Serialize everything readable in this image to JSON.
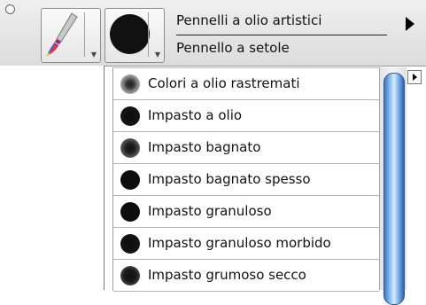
{
  "toolbar": {
    "brush_category": "Pennelli a olio artistici",
    "brush_variant": "Pennello a setole",
    "icons": [
      "close-icon",
      "brush-category-icon",
      "brush-variant-icon",
      "menu-arrow-icon",
      "well-dropdown-arrow-icon"
    ]
  },
  "variant_list": {
    "items": [
      {
        "label": "Colori a olio rastremati",
        "icon": "soft-gray-dot-icon",
        "icon_color": "#5a5a5a"
      },
      {
        "label": "Impasto a olio",
        "icon": "black-dot-icon",
        "icon_color": "#111111"
      },
      {
        "label": "Impasto bagnato",
        "icon": "soft-gray-dot-icon",
        "icon_color": "#444444"
      },
      {
        "label": "Impasto bagnato spesso",
        "icon": "black-dot-icon",
        "icon_color": "#0d0d0d"
      },
      {
        "label": "Impasto granuloso",
        "icon": "black-dot-icon",
        "icon_color": "#0d0d0d"
      },
      {
        "label": "Impasto granuloso morbido",
        "icon": "black-dot-icon",
        "icon_color": "#141414"
      },
      {
        "label": "Impasto grumoso secco",
        "icon": "soft-gray-dot-icon",
        "icon_color": "#2a2a2a"
      }
    ]
  },
  "colors": {
    "scroll_thumb": "#5a9be0",
    "accent": "#2f63b0"
  }
}
